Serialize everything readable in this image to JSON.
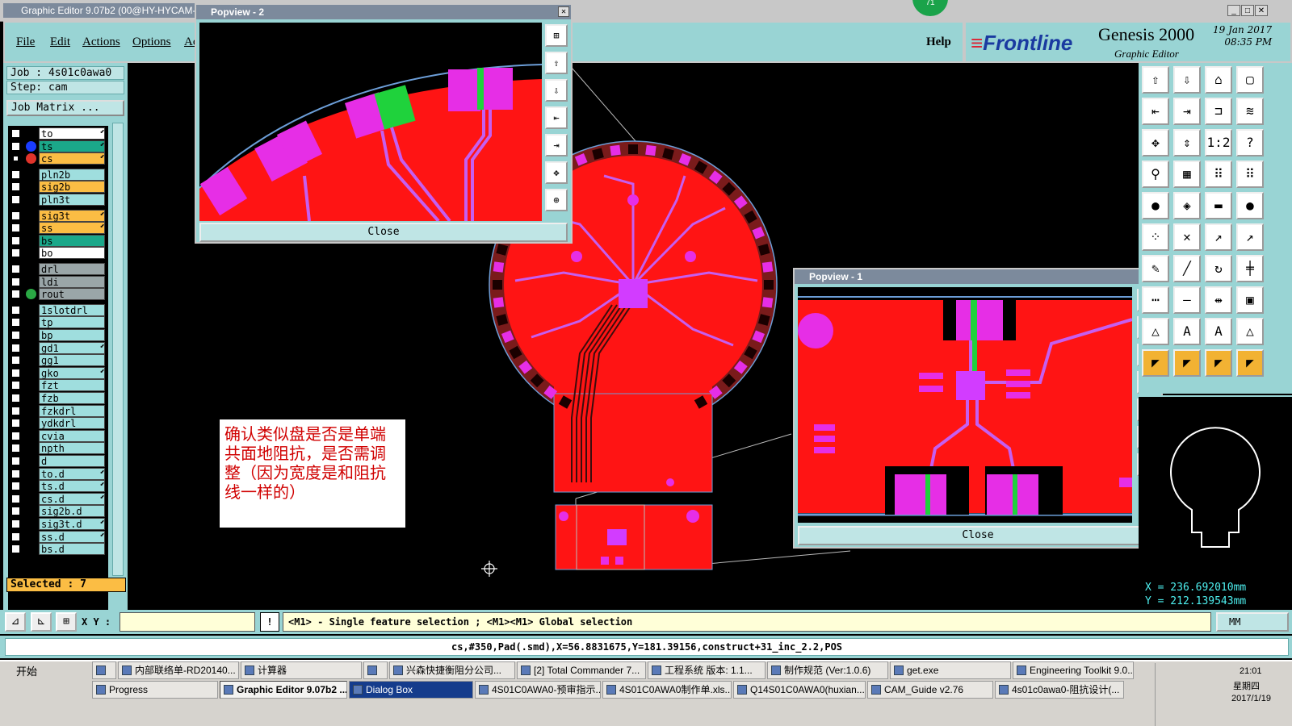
{
  "window": {
    "title": "Graphic Editor 9.07b2 (00@HY-HYCAM-",
    "menu": [
      "File",
      "Edit",
      "Actions",
      "Options",
      "Ac"
    ],
    "help": "Help",
    "badge": "71"
  },
  "brand": {
    "logo": "Frontline",
    "product": "Genesis 2000",
    "module": "Graphic Editor",
    "date": "19 Jan 2017",
    "time": "08:35 PM"
  },
  "job": {
    "job_line": "Job : 4s01c0awa0",
    "step_line": "Step: cam",
    "matrix_button": "Job Matrix ..."
  },
  "layers": [
    {
      "name": "to",
      "color": "#ffffff",
      "checked": false,
      "editable": true
    },
    {
      "name": "ts",
      "color": "#1ba88a",
      "checked": false,
      "editable": true,
      "dot": "#1a3cff"
    },
    {
      "name": "cs",
      "color": "#fbbd44",
      "checked": true,
      "editable": true,
      "dot": "#e0332a"
    },
    {
      "name": "pln2b",
      "color": "#9fdede",
      "checked": false,
      "editable": false
    },
    {
      "name": "sig2b",
      "color": "#fbbd44",
      "checked": false,
      "editable": false
    },
    {
      "name": "pln3t",
      "color": "#9fdede",
      "checked": false,
      "editable": false
    },
    {
      "name": "sig3t",
      "color": "#fbbd44",
      "checked": false,
      "editable": true
    },
    {
      "name": "ss",
      "color": "#fbbd44",
      "checked": false,
      "editable": true
    },
    {
      "name": "bs",
      "color": "#1ba88a",
      "checked": false,
      "editable": false
    },
    {
      "name": "bo",
      "color": "#ffffff",
      "checked": false,
      "editable": false
    },
    {
      "name": "drl",
      "color": "#9aa6a8",
      "checked": false,
      "editable": false
    },
    {
      "name": "ldi",
      "color": "#9aa6a8",
      "checked": false,
      "editable": false
    },
    {
      "name": "rout",
      "color": "#9aa6a8",
      "checked": false,
      "editable": false,
      "dot": "#2aa844"
    },
    {
      "name": "1slotdrl",
      "color": "#9fdede",
      "checked": false,
      "editable": false
    },
    {
      "name": "tp",
      "color": "#9fdede",
      "checked": false,
      "editable": false
    },
    {
      "name": "bp",
      "color": "#9fdede",
      "checked": false,
      "editable": false
    },
    {
      "name": "gd1",
      "color": "#9fdede",
      "checked": false,
      "editable": true
    },
    {
      "name": "gg1",
      "color": "#9fdede",
      "checked": false,
      "editable": false
    },
    {
      "name": "gko",
      "color": "#9fdede",
      "checked": false,
      "editable": true
    },
    {
      "name": "fzt",
      "color": "#9fdede",
      "checked": false,
      "editable": false
    },
    {
      "name": "fzb",
      "color": "#9fdede",
      "checked": false,
      "editable": false
    },
    {
      "name": "fzkdrl",
      "color": "#9fdede",
      "checked": false,
      "editable": false
    },
    {
      "name": "ydkdrl",
      "color": "#9fdede",
      "checked": false,
      "editable": false
    },
    {
      "name": "cvia",
      "color": "#9fdede",
      "checked": false,
      "editable": false
    },
    {
      "name": "npth",
      "color": "#9fdede",
      "checked": false,
      "editable": false
    },
    {
      "name": "d",
      "color": "#9fdede",
      "checked": false,
      "editable": false
    },
    {
      "name": "to.d",
      "color": "#9fdede",
      "checked": false,
      "editable": true
    },
    {
      "name": "ts.d",
      "color": "#9fdede",
      "checked": false,
      "editable": true
    },
    {
      "name": "cs.d",
      "color": "#9fdede",
      "checked": false,
      "editable": true
    },
    {
      "name": "sig2b.d",
      "color": "#9fdede",
      "checked": false,
      "editable": false
    },
    {
      "name": "sig3t.d",
      "color": "#9fdede",
      "checked": false,
      "editable": true
    },
    {
      "name": "ss.d",
      "color": "#9fdede",
      "checked": false,
      "editable": true
    },
    {
      "name": "bs.d",
      "color": "#9fdede",
      "checked": false,
      "editable": false
    }
  ],
  "selected": "Selected : 7",
  "popview2": {
    "title": "Popview - 2",
    "close": "Close"
  },
  "popview1": {
    "title": "Popview - 1",
    "close": "Close"
  },
  "annotation": "确认类似盘是否是单端共面地阻抗，是否需调整（因为宽度是和阻抗线一样的）",
  "coords": {
    "x": "X = 236.692010mm",
    "y": "Y = 212.139543mm"
  },
  "command": {
    "xy_label": "X Y :",
    "hint": "<M1> - Single feature selection ; <M1><M1> Global selection",
    "units": "MM"
  },
  "status": "cs,#350,Pad(.smd),X=56.8831675,Y=181.39156,construct+31_inc_2.2,POS",
  "tools": [
    "⇧",
    "⇩",
    "⌂",
    "▢",
    "⇤",
    "⇥",
    "⊐",
    "≋",
    "✥",
    "⇕",
    "1:2",
    "?",
    "⚲",
    "▦",
    "⠿",
    "⠿",
    "●",
    "◈",
    "▬",
    "●",
    "⁘",
    "✕",
    "↗",
    "↗",
    "✎",
    "╱",
    "↻",
    "╪",
    "⋯",
    "—",
    "⇹",
    "▣",
    "△",
    "A",
    "A",
    "△",
    "◤",
    "◤",
    "◤",
    "◤"
  ],
  "taskbar": {
    "start": "开始",
    "row1": [
      "",
      "内部联络单-RD20140...",
      "计算器",
      "",
      "兴森快捷衡阻分公司...",
      "[2] Total Commander 7...",
      "工程系统  版本: 1.1...",
      "制作规范 (Ver:1.0.6)",
      "get.exe",
      "Engineering Toolkit 9.0..."
    ],
    "row2": [
      "Progress",
      "Graphic Editor 9.07b2 ...",
      "Dialog Box",
      "4S01C0AWA0-预审指示...",
      "4S01C0AWA0制作单.xls...",
      "Q14S01C0AWA0(huxian...",
      "CAM_Guide v2.76",
      "4s01c0awa0-阻抗设计(..."
    ],
    "time": "21:01",
    "day": "星期四",
    "date": "2017/1/19"
  }
}
